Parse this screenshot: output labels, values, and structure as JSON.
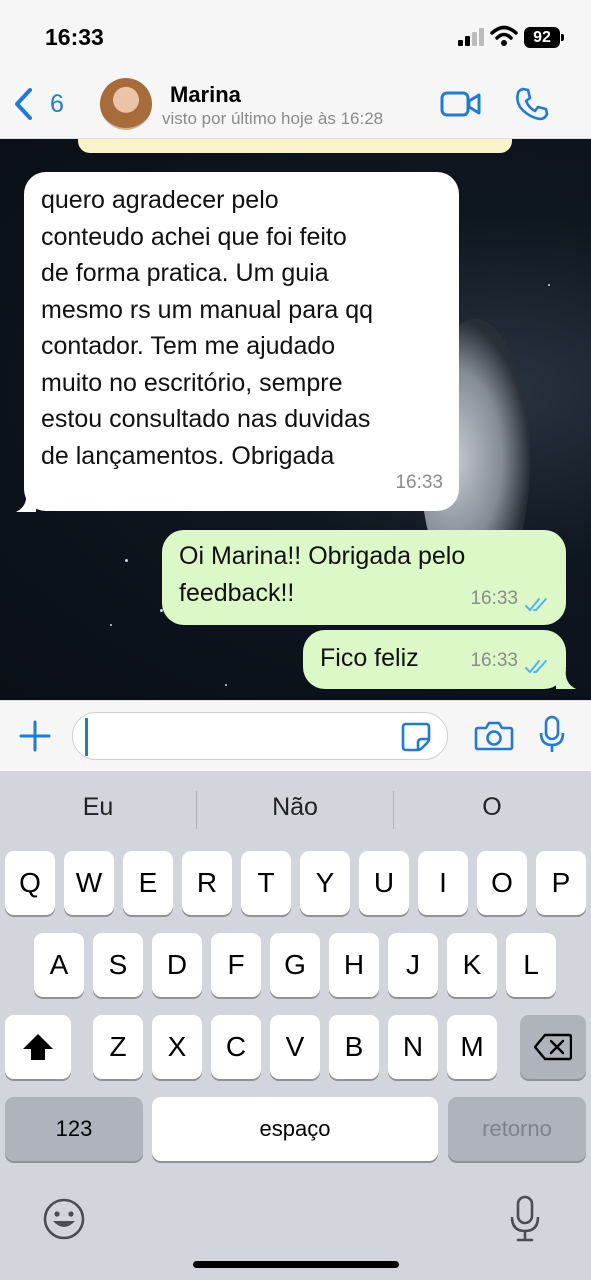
{
  "status_bar": {
    "time": "16:33",
    "battery_level": "92",
    "icons": [
      "signal-icon",
      "wifi-icon",
      "battery-icon"
    ]
  },
  "header": {
    "back_count": "6",
    "contact_name": "Marina",
    "contact_status": "visto por último hoje às 16:28",
    "icons": [
      "back-chevron-icon",
      "video-call-icon",
      "phone-icon"
    ]
  },
  "messages": [
    {
      "direction": "incoming",
      "text": "quero agradecer pelo\nconteudo achei que foi feito\nde forma pratica. Um guia\nmesmo rs um manual para qq\ncontador. Tem me ajudado\nmuito no escritório, sempre\nestou consultado nas duvidas\nde lançamentos. Obrigada",
      "time": "16:33"
    },
    {
      "direction": "outgoing",
      "text": "Oi Marina!! Obrigada pelo\nfeedback!!",
      "time": "16:33",
      "status": "read"
    },
    {
      "direction": "outgoing",
      "text": "Fico feliz",
      "time": "16:33",
      "status": "read"
    }
  ],
  "input_bar": {
    "placeholder": "",
    "icons": [
      "plus-icon",
      "sticker-icon",
      "camera-icon",
      "microphone-icon"
    ]
  },
  "keyboard": {
    "suggestions": [
      "Eu",
      "Não",
      "O"
    ],
    "row1": [
      "Q",
      "W",
      "E",
      "R",
      "T",
      "Y",
      "U",
      "I",
      "O",
      "P"
    ],
    "row2": [
      "A",
      "S",
      "D",
      "F",
      "G",
      "H",
      "J",
      "K",
      "L"
    ],
    "row3": [
      "Z",
      "X",
      "C",
      "V",
      "B",
      "N",
      "M"
    ],
    "numbers_key": "123",
    "space_key": "espaço",
    "return_key": "retorno",
    "icons": [
      "shift-icon",
      "backspace-icon",
      "emoji-icon",
      "dictation-icon"
    ]
  },
  "colors": {
    "accent": "#1f7ae0",
    "outgoing_bubble": "#dcf8c6",
    "incoming_bubble": "#ffffff",
    "read_ticks": "#4fb3f6"
  }
}
